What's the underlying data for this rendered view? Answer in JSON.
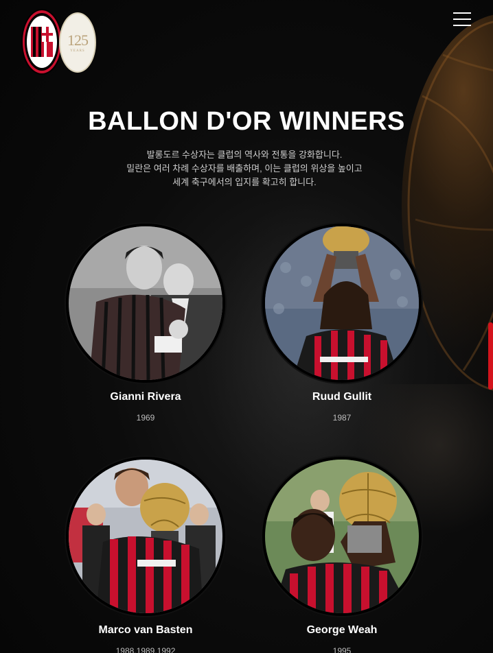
{
  "header": {
    "logo_club": "ACM",
    "logo_year": "1899",
    "anniversary_number": "125",
    "anniversary_text": "YEARS"
  },
  "section": {
    "title": "BALLON D'OR WINNERS",
    "description_lines": [
      "발롱도르 수상자는 클럽의 역사와 전통을 강화합니다.",
      "밀란은 여러 차례 수상자를 배출하며, 이는 클럽의 위상을 높이고",
      "세계 축구에서의 입지를 확고히 합니다."
    ]
  },
  "winners": [
    {
      "name": "Gianni Rivera",
      "year": "1969"
    },
    {
      "name": "Ruud Gullit",
      "year": "1987"
    },
    {
      "name": "Marco van Basten",
      "year": "1988,1989,1992"
    },
    {
      "name": "George Weah",
      "year": "1995"
    }
  ],
  "colors": {
    "background": "#070707",
    "accent_red": "#d3131c",
    "gold": "#c9a24a"
  },
  "icons": {
    "menu": "hamburger-menu-icon"
  }
}
